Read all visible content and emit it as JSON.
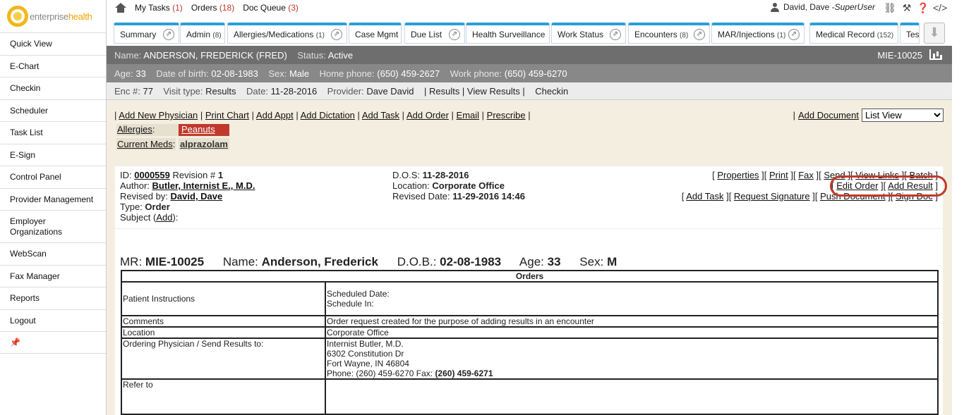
{
  "brand": {
    "enterprise": "enterprise",
    "health": "health"
  },
  "sidebar": {
    "items": [
      {
        "label": "Quick View"
      },
      {
        "label": "E-Chart"
      },
      {
        "label": "Checkin"
      },
      {
        "label": "Scheduler"
      },
      {
        "label": "Task List"
      },
      {
        "label": "E-Sign"
      },
      {
        "label": "Control Panel"
      },
      {
        "label": "Provider Management"
      },
      {
        "label": "Employer Organizations"
      },
      {
        "label": "WebScan"
      },
      {
        "label": "Fax Manager"
      },
      {
        "label": "Reports"
      },
      {
        "label": "Logout"
      }
    ],
    "pin_icon": "📌"
  },
  "topbar": {
    "my_tasks": "My Tasks",
    "my_tasks_count": "(1)",
    "orders": "Orders",
    "orders_count": "(18)",
    "doc_queue": "Doc Queue",
    "doc_queue_count": "(3)",
    "user_name": "David, Dave - ",
    "user_role": "SuperUser",
    "icons": [
      "link-icon",
      "magic-wand-icon",
      "help-icon",
      "code-icon"
    ]
  },
  "tabs": [
    {
      "label": "Summary",
      "count": ""
    },
    {
      "label": "Admin",
      "count": "(8)"
    },
    {
      "label": "Allergies/Medications",
      "count": "(1)"
    },
    {
      "label": "Case Mgmt",
      "count": ""
    },
    {
      "label": "Due List",
      "count": ""
    },
    {
      "label": "Health Surveillance",
      "count": ""
    },
    {
      "label": "Work Status",
      "count": ""
    },
    {
      "label": "Encounters",
      "count": "(8)"
    },
    {
      "label": "MAR/Injections",
      "count": "(1)"
    },
    {
      "label": "Medical Record",
      "count": "(152)"
    },
    {
      "label": "Tes",
      "count": ""
    }
  ],
  "patient": {
    "name_label": "Name:",
    "name": "ANDERSON, FREDERICK (FRED)",
    "status_label": "Status:",
    "status": "Active",
    "mrn": "MIE-10025",
    "age_label": "Age:",
    "age": "33",
    "dob_label": "Date of birth:",
    "dob": "02-08-1983",
    "sex_label": "Sex:",
    "sex": "Male",
    "home_label": "Home phone:",
    "home_phone": "(650) 459-2627",
    "work_label": "Work phone:",
    "work_phone": "(650) 459-6270"
  },
  "encounter": {
    "enc_label": "Enc #:",
    "enc": "77",
    "visit_label": "Visit type:",
    "visit_type": "Results",
    "date_label": "Date:",
    "date": "11-28-2016",
    "provider_label": "Provider:",
    "provider": "Dave David",
    "links": "| Results | View Results |",
    "checkin": "Checkin"
  },
  "actions": {
    "add_new_physician": "Add New Physician",
    "print_chart": "Print Chart",
    "add_appt": "Add Appt",
    "add_dictation": "Add Dictation",
    "add_task": "Add Task",
    "add_order": "Add Order",
    "email": "Email",
    "prescribe": "Prescribe",
    "add_document": "Add Document",
    "view_select": "List View"
  },
  "allergies": {
    "label": "Allergies",
    "value": "Peanuts"
  },
  "meds": {
    "label": "Current Meds",
    "value": "alprazolam"
  },
  "document": {
    "id_label": "ID:",
    "id": "0000559",
    "revision_label": "Revision #",
    "revision": "1",
    "author_label": "Author:",
    "author": "Butler, Internist E., M.D.",
    "revised_by_label": "Revised by:",
    "revised_by": "David, Dave",
    "type_label": "Type:",
    "type": "Order",
    "subject_label": "Subject (",
    "subject_add": "Add",
    "subject_end": "):",
    "dos_label": "D.O.S:",
    "dos": "11-28-2016",
    "location_label": "Location:",
    "location": "Corporate Office",
    "revised_date_label": "Revised Date:",
    "revised_date": "11-29-2016 14:46",
    "links1": {
      "properties": "Properties",
      "print": "Print",
      "fax": "Fax",
      "send": "Send",
      "view_links": "View Links",
      "batch": "Batch"
    },
    "links2": {
      "edit_order": "Edit Order",
      "add_result": "Add Result"
    },
    "links3": {
      "add_task": "Add Task",
      "request_signature": "Request Signature",
      "push_document": "Push Document",
      "sign_doc": "Sign Doc"
    }
  },
  "order_doc": {
    "mr_label": "MR:",
    "mr": "MIE-10025",
    "name_label": "Name:",
    "name": "Anderson, Frederick",
    "dob_label": "D.O.B.:",
    "dob": "02-08-1983",
    "age_label": "Age:",
    "age": "33",
    "sex_label": "Sex:",
    "sex": "M",
    "table_title": "Orders",
    "rows": {
      "patient_instructions": {
        "key": "Patient Instructions",
        "line1": "Scheduled Date:",
        "line2": "Schedule In:"
      },
      "comments": {
        "key": "Comments",
        "value": "Order request created for the purpose of adding results in an encounter"
      },
      "location": {
        "key": "Location",
        "value": "Corporate Office"
      },
      "ordering": {
        "key": "Ordering Physician / Send Results to:",
        "line1": "Internist Butler, M.D.",
        "line2": "6302 Constitution Dr",
        "line3": "Fort Wayne, IN 46804",
        "phone": "Phone: (260) 459-6270 Fax: ",
        "fax": "(260) 459-6271"
      },
      "refer_to": {
        "key": "Refer to",
        "value": ""
      }
    }
  }
}
